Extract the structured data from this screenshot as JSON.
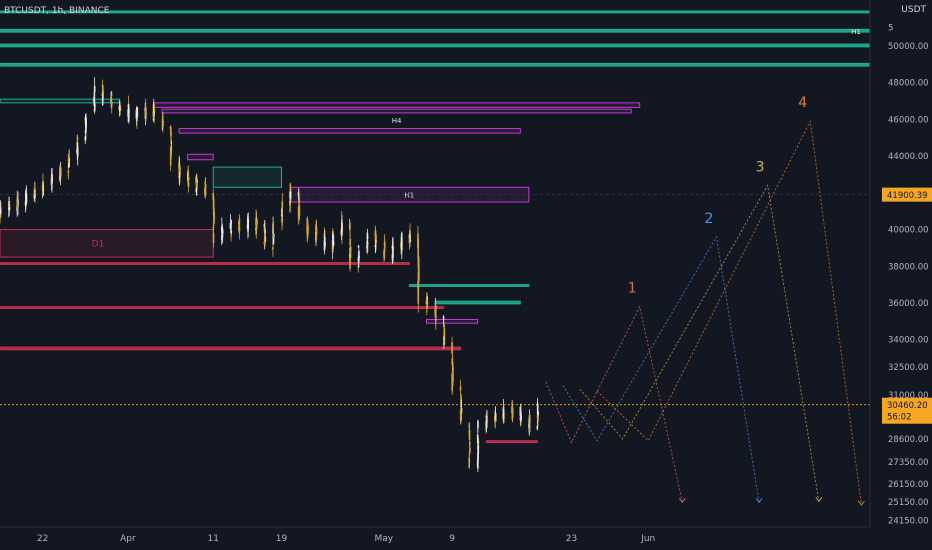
{
  "header": {
    "symbol": "BTCUSDT, 1h, BINANCE",
    "currency": "USDT"
  },
  "colors": {
    "bg": "#131722",
    "up": "#e8e6e0",
    "down": "#d4a632",
    "grid": "#1e222d",
    "teal": "#1fae94",
    "magenta": "#c43ad6",
    "red": "#c2304c",
    "axis_text": "#b2b5be",
    "price_tag": "#f5a623",
    "wave1": "#e0666b",
    "wave2": "#4d8fe0",
    "wave3": "#c7b34a",
    "wave4": "#d9822b"
  },
  "chart_data": {
    "type": "candlestick",
    "title": "",
    "instrument": "BTCUSDT",
    "timeframe": "1h",
    "exchange": "BINANCE",
    "ylim": [
      23800,
      52500
    ],
    "xlim": [
      "2022-03-17",
      "2022-06-27"
    ],
    "y_ticks": [
      24150,
      25150,
      26150,
      27350,
      28600,
      30460.2,
      31000,
      32500,
      34000,
      36000,
      38000,
      40000,
      41900.39,
      44000,
      46000,
      48000,
      50000,
      51000
    ],
    "y_tick_labels": [
      "24150.00",
      "25150.00",
      "26150.00",
      "27350.00",
      "28600.00",
      "30460.20",
      "31000.00",
      "32500.00",
      "34000.00",
      "36000.00",
      "38000.00",
      "40000.00",
      "41900.39",
      "44000.00",
      "46000.00",
      "48000.00",
      "50000.00",
      "5"
    ],
    "x_ticks": [
      {
        "date": "2022-03-22",
        "label": "22"
      },
      {
        "date": "2022-04-01",
        "label": "Apr"
      },
      {
        "date": "2022-04-11",
        "label": "11"
      },
      {
        "date": "2022-04-19",
        "label": "19"
      },
      {
        "date": "2022-05-01",
        "label": "May"
      },
      {
        "date": "2022-05-09",
        "label": "9"
      },
      {
        "date": "2022-05-23",
        "label": "23"
      },
      {
        "date": "2022-06-01",
        "label": "Jun"
      }
    ],
    "grid": false,
    "price_path": [
      [
        "2022-03-17",
        41000
      ],
      [
        "2022-03-20",
        41500
      ],
      [
        "2022-03-22",
        42200
      ],
      [
        "2022-03-25",
        43200
      ],
      [
        "2022-03-27",
        44800
      ],
      [
        "2022-03-29",
        47700
      ],
      [
        "2022-03-31",
        46800
      ],
      [
        "2022-04-02",
        46200
      ],
      [
        "2022-04-04",
        46500
      ],
      [
        "2022-04-06",
        45800
      ],
      [
        "2022-04-07",
        43500
      ],
      [
        "2022-04-09",
        42600
      ],
      [
        "2022-04-11",
        42000
      ],
      [
        "2022-04-12",
        39600
      ],
      [
        "2022-04-14",
        40200
      ],
      [
        "2022-04-17",
        40300
      ],
      [
        "2022-04-18",
        39100
      ],
      [
        "2022-04-20",
        41400
      ],
      [
        "2022-04-21",
        42300
      ],
      [
        "2022-04-22",
        40400
      ],
      [
        "2022-04-25",
        39100
      ],
      [
        "2022-04-27",
        40400
      ],
      [
        "2022-04-28",
        38000
      ],
      [
        "2022-04-30",
        39800
      ],
      [
        "2022-05-02",
        38500
      ],
      [
        "2022-05-04",
        39500
      ],
      [
        "2022-05-05",
        39700
      ],
      [
        "2022-05-06",
        36200
      ],
      [
        "2022-05-08",
        35300
      ],
      [
        "2022-05-09",
        33600
      ],
      [
        "2022-05-10",
        31200
      ],
      [
        "2022-05-11",
        29500
      ],
      [
        "2022-05-12",
        27000
      ],
      [
        "2022-05-13",
        29300
      ],
      [
        "2022-05-15",
        30000
      ],
      [
        "2022-05-17",
        30100
      ],
      [
        "2022-05-19",
        29300
      ],
      [
        "2022-05-20",
        30460.2
      ]
    ],
    "current_price": 30460.2,
    "countdown": "56:02",
    "crosshair_price": 41900.39,
    "zones": [
      {
        "color": "teal",
        "start": "2022-03-17",
        "end": "2022-06-27",
        "top": 51900,
        "bottom": 51800,
        "label": ""
      },
      {
        "color": "teal",
        "start": "2022-03-17",
        "end": "2022-06-27",
        "top": 50900,
        "bottom": 50750,
        "label": "H1"
      },
      {
        "color": "teal",
        "start": "2022-03-17",
        "end": "2022-06-27",
        "top": 50100,
        "bottom": 49950,
        "label": ""
      },
      {
        "color": "teal",
        "start": "2022-03-17",
        "end": "2022-06-27",
        "top": 49050,
        "bottom": 48900,
        "label": ""
      },
      {
        "color": "magenta",
        "start": "2022-04-04",
        "end": "2022-05-31",
        "top": 46900,
        "bottom": 46650,
        "label": ""
      },
      {
        "color": "magenta",
        "start": "2022-04-05",
        "end": "2022-05-30",
        "top": 46550,
        "bottom": 46350,
        "label": "H4"
      },
      {
        "color": "magenta",
        "start": "2022-04-07",
        "end": "2022-05-17",
        "top": 45500,
        "bottom": 45250,
        "label": ""
      },
      {
        "color": "teal",
        "start": "2022-03-17",
        "end": "2022-03-31",
        "top": 47100,
        "bottom": 46900,
        "label": ""
      },
      {
        "color": "teal",
        "start": "2022-04-11",
        "end": "2022-04-19",
        "top": 43400,
        "bottom": 42300,
        "label": ""
      },
      {
        "color": "magenta",
        "start": "2022-04-08",
        "end": "2022-04-11",
        "top": 44100,
        "bottom": 43800,
        "label": ""
      },
      {
        "color": "magenta",
        "start": "2022-04-20",
        "end": "2022-05-18",
        "top": 42300,
        "bottom": 41500,
        "label": "H1"
      },
      {
        "color": "red",
        "start": "2022-03-17",
        "end": "2022-04-11",
        "top": 40000,
        "bottom": 38500,
        "label": "D1"
      },
      {
        "color": "red",
        "start": "2022-03-17",
        "end": "2022-05-04",
        "top": 38200,
        "bottom": 38100,
        "label": ""
      },
      {
        "color": "teal",
        "start": "2022-05-04",
        "end": "2022-05-18",
        "top": 37000,
        "bottom": 36900,
        "label": ""
      },
      {
        "color": "teal",
        "start": "2022-05-07",
        "end": "2022-05-17",
        "top": 36100,
        "bottom": 35950,
        "label": ""
      },
      {
        "color": "red",
        "start": "2022-03-17",
        "end": "2022-05-08",
        "top": 35800,
        "bottom": 35700,
        "label": ""
      },
      {
        "color": "magenta",
        "start": "2022-05-06",
        "end": "2022-05-12",
        "top": 35100,
        "bottom": 34900,
        "label": ""
      },
      {
        "color": "red",
        "start": "2022-03-17",
        "end": "2022-05-10",
        "top": 33600,
        "bottom": 33450,
        "label": ""
      },
      {
        "color": "red",
        "start": "2022-05-13",
        "end": "2022-05-19",
        "top": 28500,
        "bottom": 28400,
        "label": ""
      }
    ],
    "wave_projections": [
      {
        "label": "1",
        "color": "wave1",
        "points": [
          [
            "2022-05-20",
            31700
          ],
          [
            "2022-05-23",
            28400
          ],
          [
            "2022-05-31",
            35800
          ],
          [
            "2022-06-05",
            25150
          ]
        ]
      },
      {
        "label": "2",
        "color": "wave2",
        "points": [
          [
            "2022-05-22",
            31500
          ],
          [
            "2022-05-26",
            28500
          ],
          [
            "2022-06-09",
            39600
          ],
          [
            "2022-06-14",
            25150
          ]
        ]
      },
      {
        "label": "3",
        "color": "wave3",
        "points": [
          [
            "2022-05-24",
            31300
          ],
          [
            "2022-05-29",
            28600
          ],
          [
            "2022-06-15",
            42400
          ],
          [
            "2022-06-21",
            25200
          ]
        ]
      },
      {
        "label": "4",
        "color": "wave4",
        "points": [
          [
            "2022-05-26",
            31200
          ],
          [
            "2022-06-01",
            28500
          ],
          [
            "2022-06-20",
            45900
          ],
          [
            "2022-06-26",
            25000
          ]
        ]
      }
    ]
  }
}
